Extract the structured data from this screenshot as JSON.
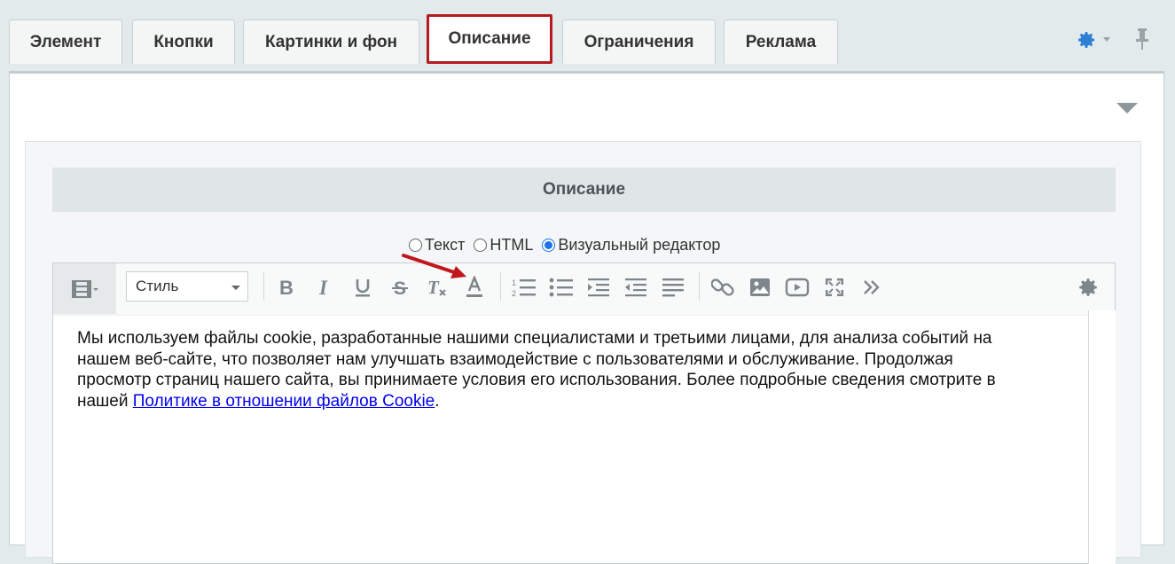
{
  "tabs": [
    {
      "label": "Элемент"
    },
    {
      "label": "Кнопки"
    },
    {
      "label": "Картинки и фон"
    },
    {
      "label": "Описание",
      "active": true
    },
    {
      "label": "Ограничения"
    },
    {
      "label": "Реклама"
    }
  ],
  "top_icons": [
    "gear-icon",
    "chevron-down-icon",
    "pin-icon"
  ],
  "section": {
    "title": "Описание"
  },
  "modes": [
    {
      "label": "Текст",
      "checked": false
    },
    {
      "label": "HTML",
      "checked": false
    },
    {
      "label": "Визуальный редактор",
      "checked": true
    }
  ],
  "toolbar": {
    "style_select_value": "Стиль",
    "buttons": [
      "view-mode-icon",
      "bold-icon",
      "italic-icon",
      "underline-icon",
      "strikethrough-icon",
      "remove-format-icon",
      "text-color-icon",
      "ordered-list-icon",
      "unordered-list-icon",
      "indent-icon",
      "outdent-icon",
      "align-icon",
      "link-icon",
      "image-icon",
      "video-icon",
      "fullscreen-icon",
      "more-icon",
      "settings-icon"
    ]
  },
  "content": {
    "line1": "Мы используем файлы cookie, разработанные нашими специалистами и третьими лицами, для анализа событий на",
    "line2": "нашем веб-сайте, что позволяет нам улучшать взаимодействие с пользователями и обслуживание. Продолжая",
    "line3": "просмотр страниц нашего сайта, вы принимаете условия его использования. Более подробные сведения смотрите в",
    "line4_prefix": "нашей ",
    "link_text": "Политике в отношении файлов Cookie",
    "line4_suffix": "."
  },
  "colors": {
    "active_tab_border": "#b31b20",
    "arrow": "#c0161c",
    "link": "#0000ee",
    "radio_checked": "#1a73e8"
  }
}
